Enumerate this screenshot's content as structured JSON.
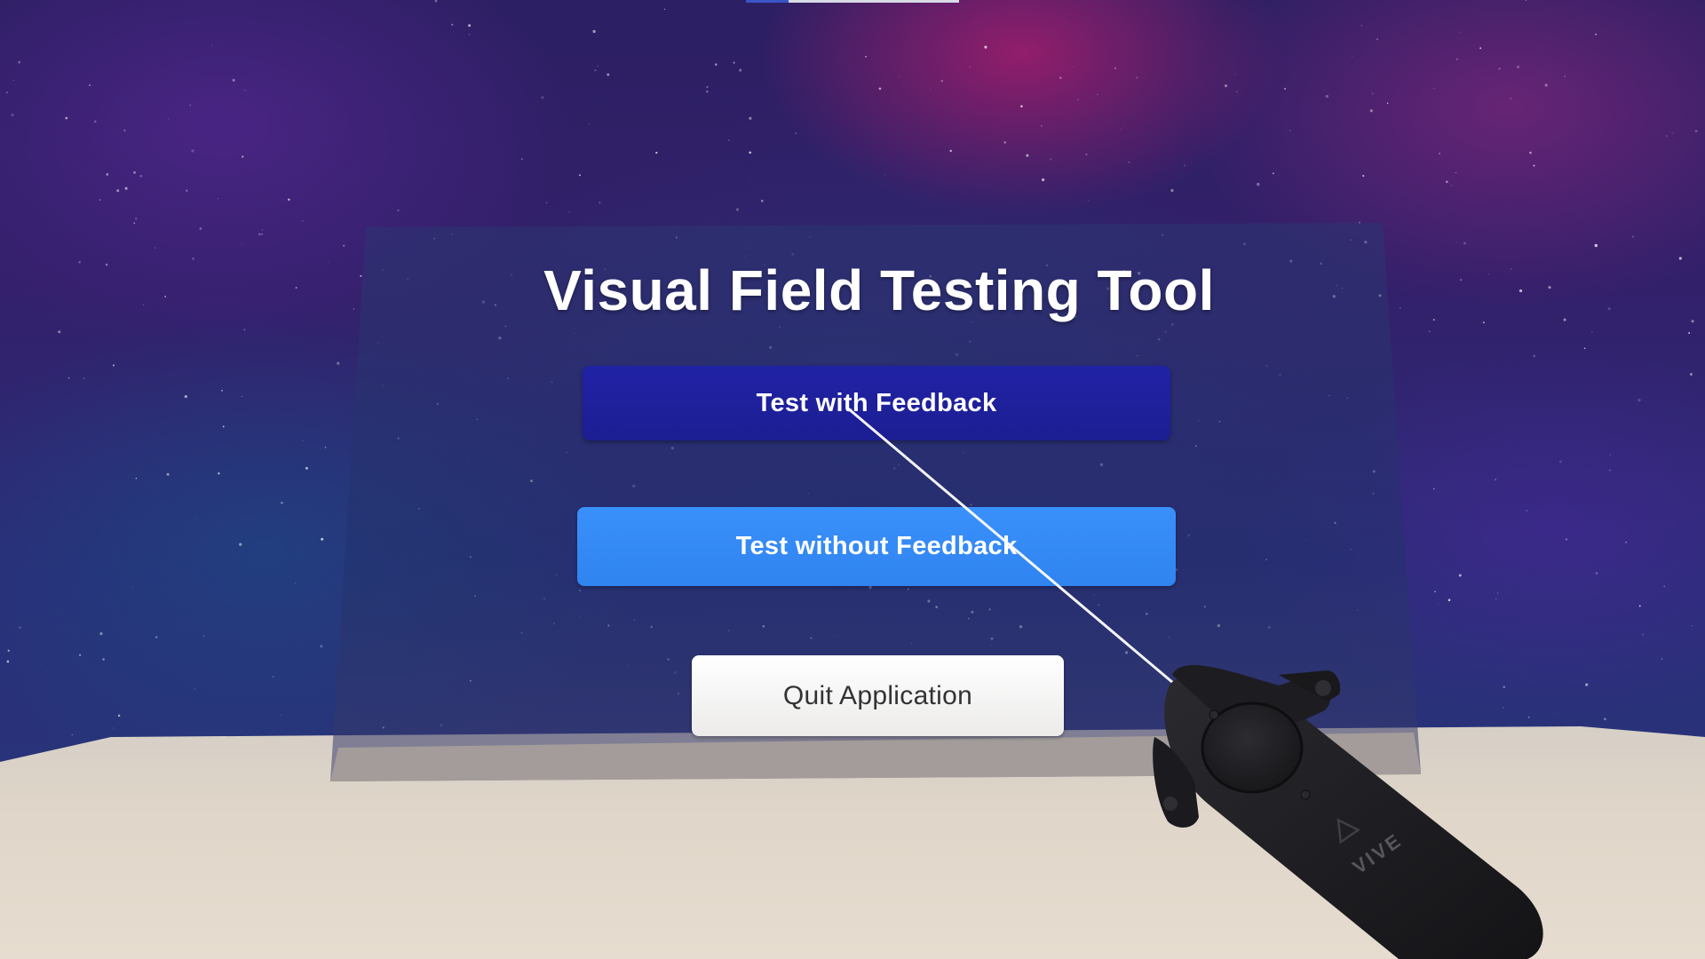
{
  "menu": {
    "title": "Visual Field Testing Tool",
    "buttons": {
      "test_with_feedback": "Test with Feedback",
      "test_without_feedback": "Test without Feedback",
      "quit": "Quit Application"
    }
  },
  "controller": {
    "brand": "VIVE",
    "icon": "vive-logo-icon"
  },
  "colors": {
    "title_text": "#ffffff",
    "button_feedback": "#1f21a0",
    "button_no_feedback": "#3389f6",
    "button_quit": "#f6f5f4",
    "floor": "#e2d8cb",
    "pointer_ray": "#ffffff",
    "controller": "#1e1e22"
  }
}
